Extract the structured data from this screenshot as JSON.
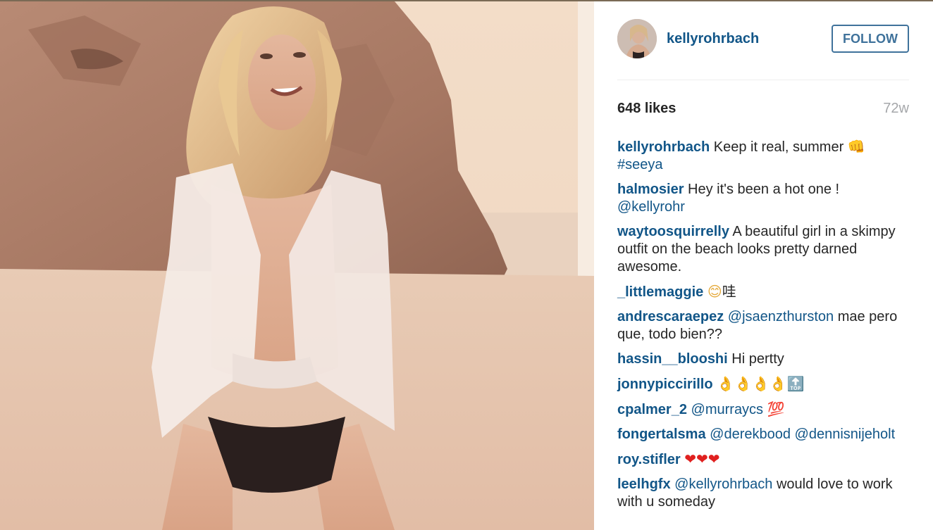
{
  "post": {
    "username": "kellyrohrbach",
    "follow_label": "FOLLOW",
    "likes": "648 likes",
    "time_ago": "72w"
  },
  "comments": [
    {
      "user": "kellyrohrbach",
      "text": "Keep it real, summer",
      "emoji": "👊",
      "tag": "#seeya"
    },
    {
      "user": "halmosier",
      "text": "Hey it's been a hot one !",
      "mention": "@kellyrohr"
    },
    {
      "user": "waytoosquirrelly",
      "text": "A beautiful girl in a skimpy outfit on the beach looks pretty darned awesome."
    },
    {
      "user": "_littlemaggie",
      "emoji": "😊",
      "text": "哇"
    },
    {
      "user": "andrescaraepez",
      "mention": "@jsaenzthurston",
      "text": "mae pero que, todo bien??"
    },
    {
      "user": "hassin__blooshi",
      "text": "Hi pertty"
    },
    {
      "user": "jonnypiccirillo",
      "emoji": "👌👌👌👌",
      "emoji2": "🔝"
    },
    {
      "user": "cpalmer_2",
      "mention": "@murraycs",
      "emoji": "💯"
    },
    {
      "user": "fongertalsma",
      "mention": "@derekbood",
      "mention2": "@dennisnijeholt"
    },
    {
      "user": "roy.stifler",
      "emoji": "❤❤❤"
    },
    {
      "user": "leelhgfx",
      "mention": "@kellyrohrbach",
      "text": "would love to work with u someday"
    }
  ],
  "colors": {
    "link": "#125688",
    "follow_border": "#3f729b",
    "text": "#262626",
    "muted": "#a5a7aa"
  }
}
